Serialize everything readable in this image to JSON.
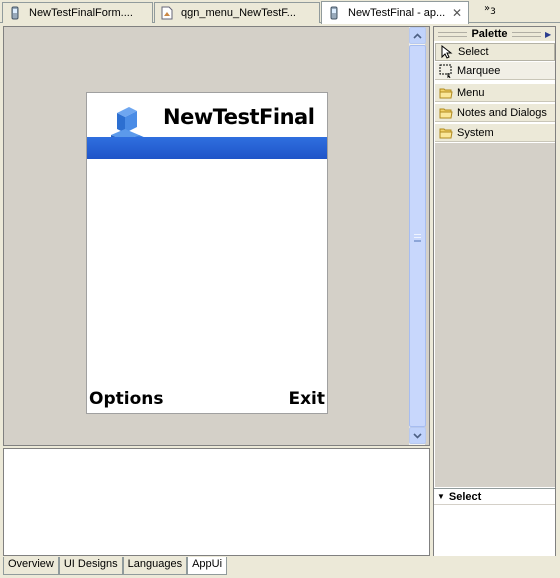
{
  "tabs": [
    {
      "label": "NewTestFinalForm....",
      "icon": "phone-file-icon"
    },
    {
      "label": "qgn_menu_NewTestF...",
      "icon": "image-file-icon"
    },
    {
      "label": "NewTestFinal - ap...",
      "icon": "phone-file-icon",
      "active": true
    }
  ],
  "tab_overflow": {
    "symbol": "»",
    "count": "3"
  },
  "phone": {
    "title": "NewTestFinal",
    "softkey_left": "Options",
    "softkey_right": "Exit",
    "band_color": "#1f54c8"
  },
  "palette": {
    "title": "Palette",
    "tools": [
      {
        "label": "Select",
        "icon": "arrow-cursor-icon",
        "selected": true
      },
      {
        "label": "Marquee",
        "icon": "marquee-icon"
      }
    ],
    "drawers": [
      {
        "label": "Menu",
        "icon": "folder-icon"
      },
      {
        "label": "Notes and Dialogs",
        "icon": "folder-icon"
      },
      {
        "label": "System",
        "icon": "folder-icon"
      }
    ]
  },
  "selection_panel": {
    "title": "Select"
  },
  "bottom_tabs": [
    {
      "label": "Overview"
    },
    {
      "label": "UI Designs"
    },
    {
      "label": "Languages"
    },
    {
      "label": "AppUi",
      "active": true
    }
  ]
}
